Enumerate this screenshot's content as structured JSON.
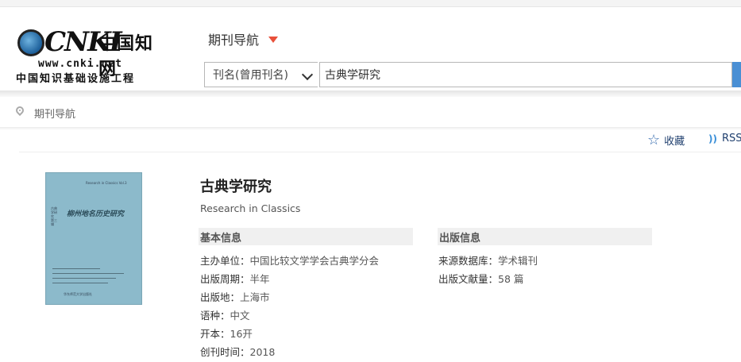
{
  "logo": {
    "brand": "CNKI",
    "brand_cn": "中国知网",
    "url": "www.cnki.net",
    "tagline": "中国知识基础设施工程"
  },
  "header": {
    "nav_title": "期刊导航",
    "search": {
      "field_selected": "刊名(曾用刊名)",
      "query": "古典学研究"
    }
  },
  "breadcrumb": {
    "current": "期刊导航"
  },
  "toolbar": {
    "favorite_label": "收藏",
    "rss_label": "RSS"
  },
  "journal": {
    "title_cn": "古典学研究",
    "title_en": "Research in Classics",
    "cover": {
      "title": "柳州地名历史研究",
      "subtitle": "Research in Classics Vol.3",
      "series": "古典学研究 第三辑",
      "publisher": "华东师范大学出版社"
    }
  },
  "basic_info": {
    "heading": "基本信息",
    "rows": [
      {
        "label": "主办单位：",
        "value": "中国比较文学学会古典学分会"
      },
      {
        "label": "出版周期：",
        "value": "半年"
      },
      {
        "label": "出版地：",
        "value": "上海市"
      },
      {
        "label": "语种：",
        "value": "中文"
      },
      {
        "label": "开本：",
        "value": "16开"
      },
      {
        "label": "创刊时间：",
        "value": "2018"
      }
    ]
  },
  "publish_info": {
    "heading": "出版信息",
    "rows": [
      {
        "label": "来源数据库：",
        "value": "学术辑刊"
      },
      {
        "label": "出版文献量：",
        "value": "58 篇"
      }
    ]
  },
  "colors": {
    "accent": "#e8503a",
    "link": "#1f3f6e",
    "search_button": "#4a8fd4",
    "cover": "#8cbacb"
  }
}
